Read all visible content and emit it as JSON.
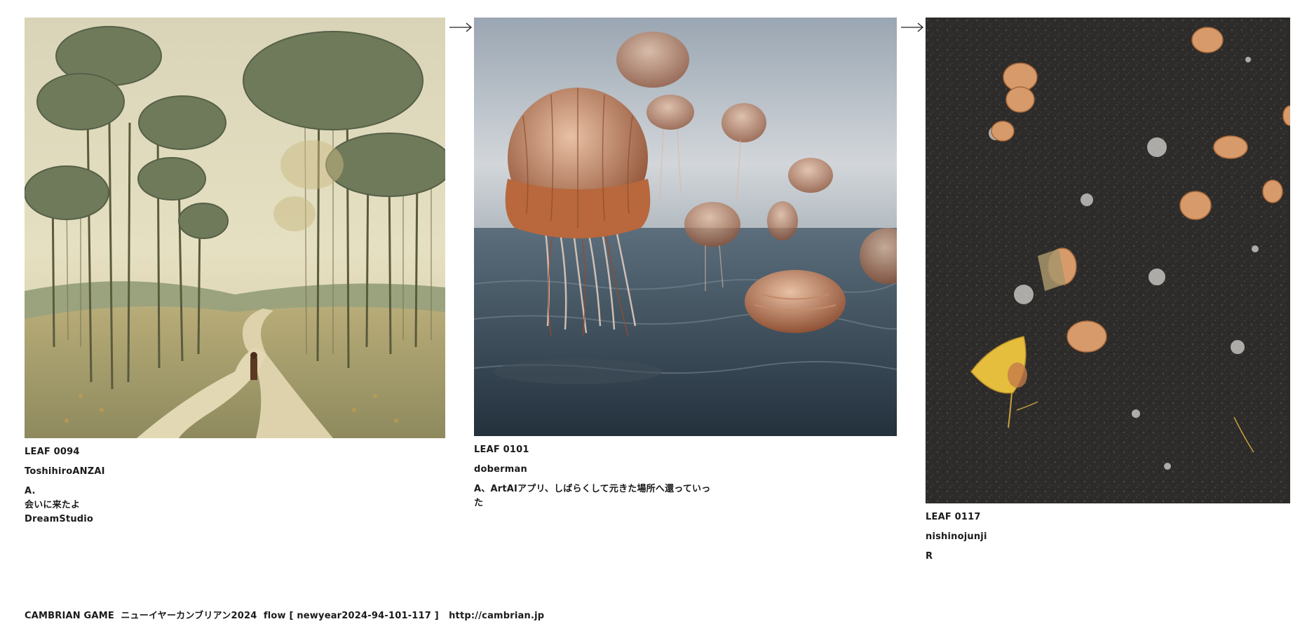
{
  "leaves": [
    {
      "id": "LEAF 0094",
      "author": "ToshihiroANZAI",
      "note_lines": [
        "A.",
        "会いに来たよ",
        "DreamStudio"
      ],
      "image_subject": "misty-mushroom-tree-forest-path"
    },
    {
      "id": "LEAF 0101",
      "author": "doberman",
      "note_lines": [
        "A、ArtAIアプリ、しばらくして元きた場所へ還っていった"
      ],
      "image_subject": "jellyfish-in-sea"
    },
    {
      "id": "LEAF 0117",
      "author": "nishinojunji",
      "note_lines": [
        "R"
      ],
      "image_subject": "ginkgo-leaves-on-asphalt"
    }
  ],
  "arrows": [
    "right-arrow-icon",
    "right-arrow-icon"
  ],
  "footer": {
    "text": "CAMBRIAN GAME  ニューイヤーカンブリアン2024  flow [ newyear2024-94-101-117 ]   http://cambrian.jp"
  },
  "colors": {
    "text": "#1a1a1a",
    "background": "#ffffff"
  }
}
